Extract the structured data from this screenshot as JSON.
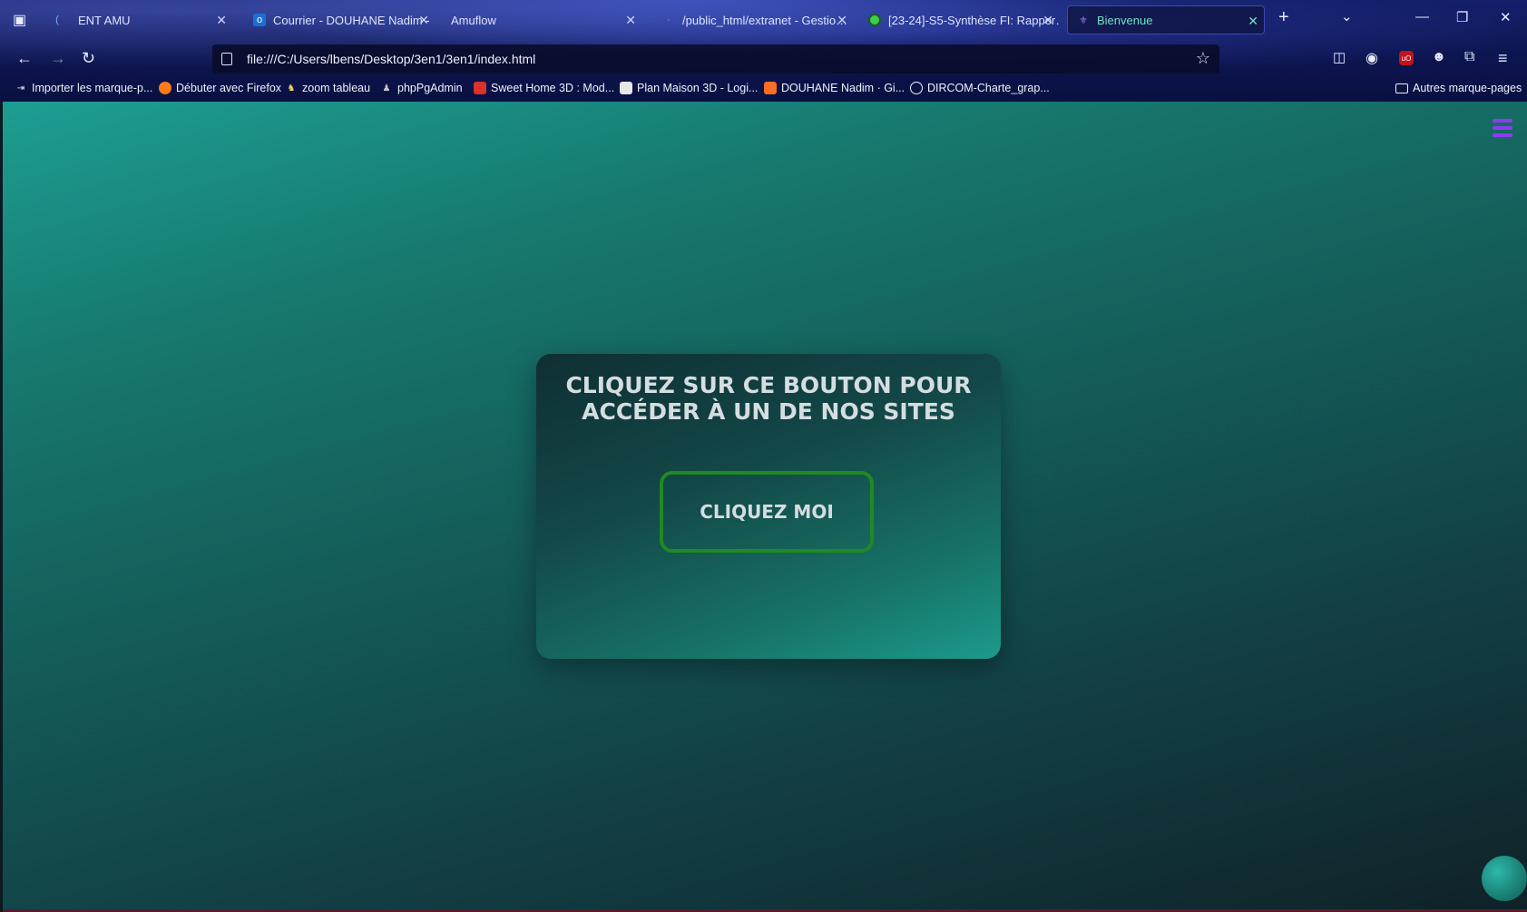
{
  "tabs": [
    {
      "title": "ENT AMU",
      "icon": "amu-icon"
    },
    {
      "title": "Courrier - DOUHANE Nadim - …",
      "icon": "outlook-icon"
    },
    {
      "title": "Amuflow",
      "icon": "amuflow-icon"
    },
    {
      "title": "/public_html/extranet - Gestio…",
      "icon": "ftp-icon"
    },
    {
      "title": "[23-24]-S5-Synthèse FI: Rappor…",
      "icon": "green-dot-icon"
    },
    {
      "title": "Bienvenue",
      "icon": "fleur-de-lis-icon",
      "active": true
    }
  ],
  "url": "file:///C:/Users/lbens/Desktop/3en1/3en1/index.html",
  "bookmarks": [
    {
      "label": "Importer les marque-p...",
      "icon": "import-icon"
    },
    {
      "label": "Débuter avec Firefox",
      "icon": "firefox-icon"
    },
    {
      "label": "zoom tableau",
      "icon": "zoom-icon"
    },
    {
      "label": "phpPgAdmin",
      "icon": "elephant-icon"
    },
    {
      "label": "Sweet Home 3D : Mod...",
      "icon": "sweethome-icon"
    },
    {
      "label": "Plan Maison 3D - Logi...",
      "icon": "plan-icon"
    },
    {
      "label": "DOUHANE Nadim · Gi...",
      "icon": "gitlab-icon"
    },
    {
      "label": "DIRCOM-Charte_grap...",
      "icon": "globe-icon"
    }
  ],
  "other_bookmarks": "Autres marque-pages",
  "page": {
    "title": "CLIQUEZ SUR CE BOUTON POUR ACCÉDER À UN DE NOS SITES",
    "button_label": "CLIQUEZ MOI"
  },
  "colors": {
    "button_border": "#1f8a22",
    "menu_icon": "#8d3cf0",
    "page_top": "#1d9e92",
    "page_bottom": "#0f2228"
  }
}
